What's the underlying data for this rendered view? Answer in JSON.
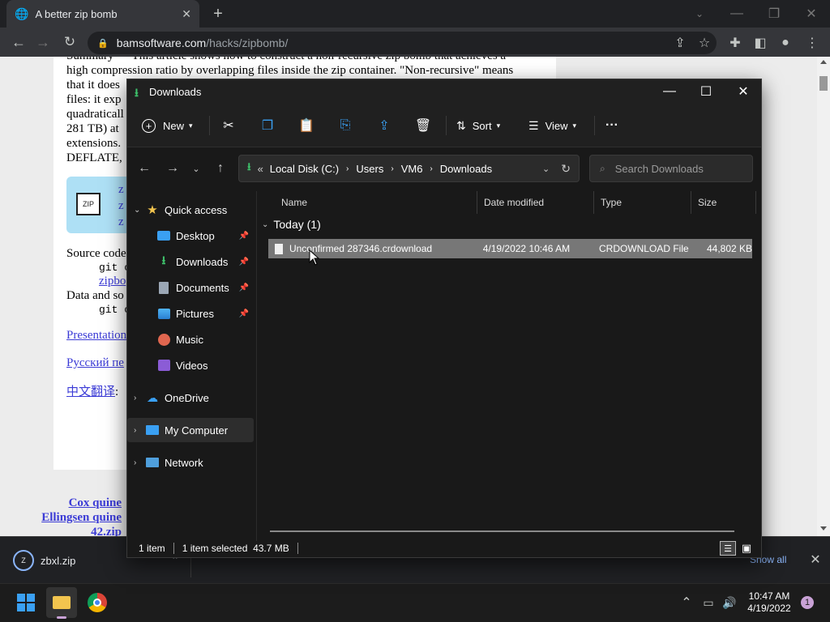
{
  "browser": {
    "tab_title": "A better zip bomb",
    "url_domain": "bamsoftware.com",
    "url_path": "/hacks/zipbomb/"
  },
  "webpage": {
    "lines": [
      "Summary — This article shows how to construct a non-recursive zip bomb that achieves a",
      "high compression ratio by overlapping files inside the zip container. \"Non-recursive\" means",
      "that it does",
      "files: it exp",
      "quadraticall",
      "281 TB) at",
      "extensions.",
      "DEFLATE,"
    ],
    "source_label": "Source code",
    "code1": "git c",
    "link1": "zipbo",
    "data_label": "Data and so",
    "code2": "git c",
    "presentation": "Presentation",
    "russian": "Русский пе",
    "chinese": "中文翻译",
    "chinese_suffix": ":",
    "bottom_links": [
      "Cox quine",
      "Ellingsen quine",
      "42.zip"
    ],
    "zip_box_lines": [
      "z",
      "z",
      "z"
    ]
  },
  "download_bar": {
    "file": "zbxl.zip",
    "show_all": "Show all"
  },
  "explorer": {
    "title": "Downloads",
    "cmd": {
      "new": "New",
      "sort": "Sort",
      "view": "View",
      "more": "···"
    },
    "address": {
      "prefix": "«",
      "crumbs": [
        "Local Disk (C:)",
        "Users",
        "VM6",
        "Downloads"
      ]
    },
    "search_placeholder": "Search Downloads",
    "nav": {
      "quick_access": "Quick access",
      "items": [
        "Desktop",
        "Downloads",
        "Documents",
        "Pictures",
        "Music",
        "Videos"
      ],
      "onedrive": "OneDrive",
      "mycomputer": "My Computer",
      "network": "Network"
    },
    "columns": {
      "name": "Name",
      "date": "Date modified",
      "type": "Type",
      "size": "Size"
    },
    "group": "Today (1)",
    "file": {
      "name": "Unconfirmed 287346.crdownload",
      "date": "4/19/2022 10:46 AM",
      "type": "CRDOWNLOAD File",
      "size": "44,802 KB"
    },
    "status": {
      "count": "1 item",
      "selected": "1 item selected  43.7 MB"
    }
  },
  "taskbar": {
    "time": "10:47 AM",
    "date": "4/19/2022",
    "badge": "1"
  },
  "colors": {
    "accent": "#0078d4",
    "folder": "#f2c44e",
    "download_green": "#3ec26b"
  }
}
